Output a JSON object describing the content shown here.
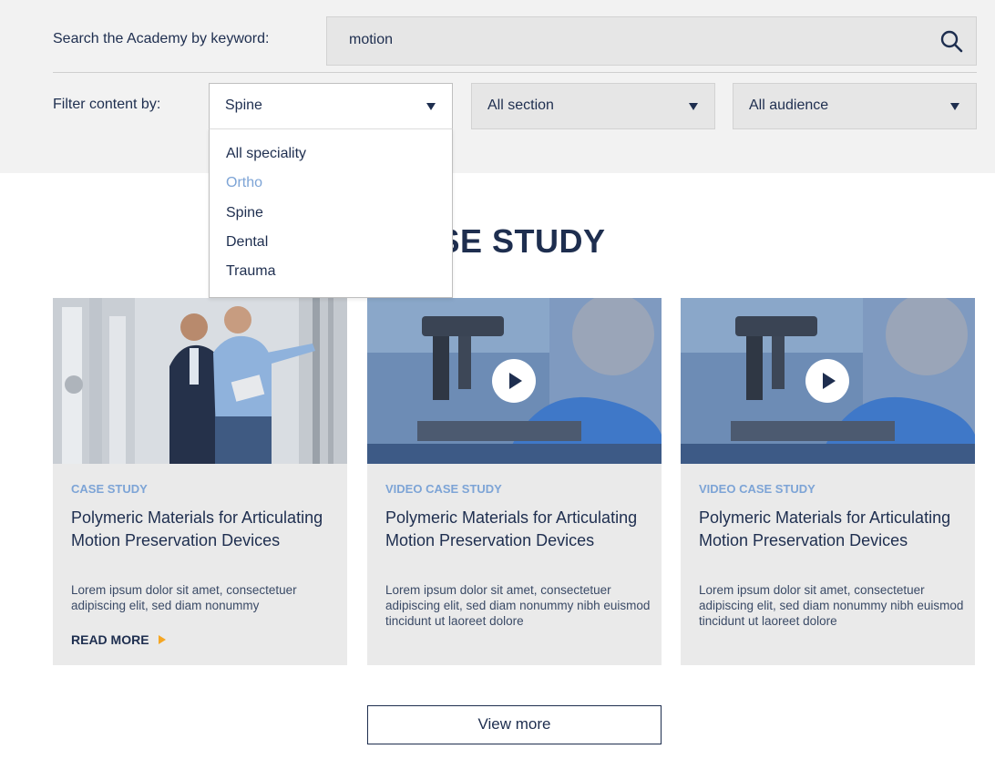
{
  "search": {
    "label": "Search the Academy by keyword:",
    "value": "motion"
  },
  "filters": {
    "label": "Filter content by:",
    "speciality": {
      "selected": "Spine",
      "options": [
        "All speciality",
        "Ortho",
        "Spine",
        "Dental",
        "Trauma"
      ],
      "hovered": "Ortho"
    },
    "section": {
      "selected": "All section"
    },
    "audience": {
      "selected": "All audience"
    }
  },
  "section_title": "CASE STUDY",
  "cards": [
    {
      "tag": "CASE STUDY",
      "title": "Polymeric Materials for Articulating Motion Preservation Devices",
      "description": "Lorem ipsum dolor sit amet, consectetuer adipiscing elit, sed diam nonummy",
      "read_more": "READ MORE",
      "image": "two-engineers-with-tablet-photo"
    },
    {
      "tag": "VIDEO CASE STUDY",
      "title": "Polymeric Materials for Articulating Motion Preservation Devices",
      "description": "Lorem ipsum dolor sit amet, consectetuer adipiscing elit, sed diam nonummy nibh euismod tincidunt ut laoreet dolore",
      "image": "scientist-microscope-video-thumbnail"
    },
    {
      "tag": "VIDEO CASE STUDY",
      "title": "Polymeric Materials for Articulating Motion Preservation Devices",
      "description": "Lorem ipsum dolor sit amet, consectetuer adipiscing elit, sed diam nonummy nibh euismod tincidunt ut laoreet dolore",
      "image": "scientist-microscope-video-thumbnail"
    }
  ],
  "view_more": "View more",
  "colors": {
    "navy": "#1e2e4f",
    "accent_blue": "#7da4d6",
    "accent_orange": "#f5a623",
    "panel_gray": "#f2f2f2",
    "card_gray": "#eaeaea"
  }
}
